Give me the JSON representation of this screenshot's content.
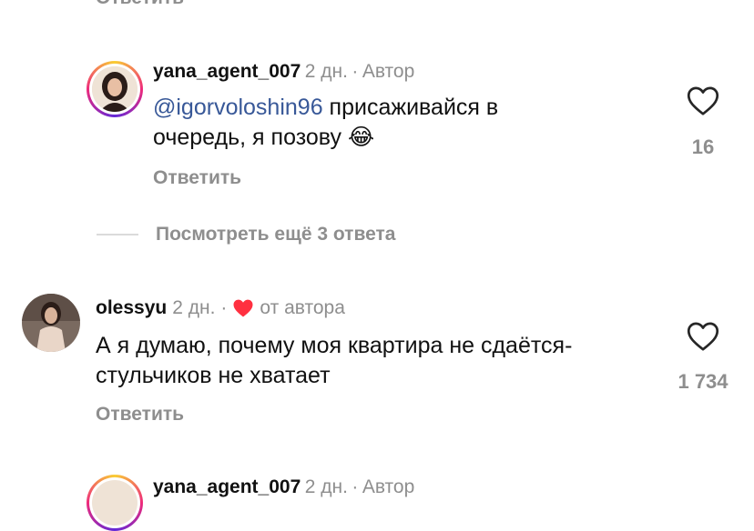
{
  "top_partial": {
    "reply_label": "Ответить"
  },
  "comments": [
    {
      "username": "yana_agent_007",
      "time": "2 дн.",
      "separator": "·",
      "badge": "Автор",
      "mention": "@igorvoloshin96",
      "text_line1_after_mention": " присаживайся в",
      "text_line2": "очередь, я позову",
      "emoji": "😂",
      "likes": "16",
      "reply_label": "Ответить"
    },
    {
      "username": "olessyu",
      "time": "2 дн.",
      "separator": "·",
      "liked_by_author_label": "от автора",
      "text_line1": "А я думаю, почему моя квартира не сдаётся-",
      "text_line2": "стульчиков не хватает",
      "likes": "1 734",
      "reply_label": "Ответить"
    }
  ],
  "view_more_replies": "Посмотреть ещё 3 ответа",
  "bottom_partial": {
    "username": "yana_agent_007",
    "time": "2 дн.",
    "separator": "·",
    "badge": "Автор"
  },
  "icons": {
    "like": "heart-outline-icon",
    "liked_by_author": "heart-filled-icon"
  },
  "colors": {
    "mention": "#385898",
    "secondary": "#8e8e8e",
    "heart_red": "#ff3040"
  }
}
